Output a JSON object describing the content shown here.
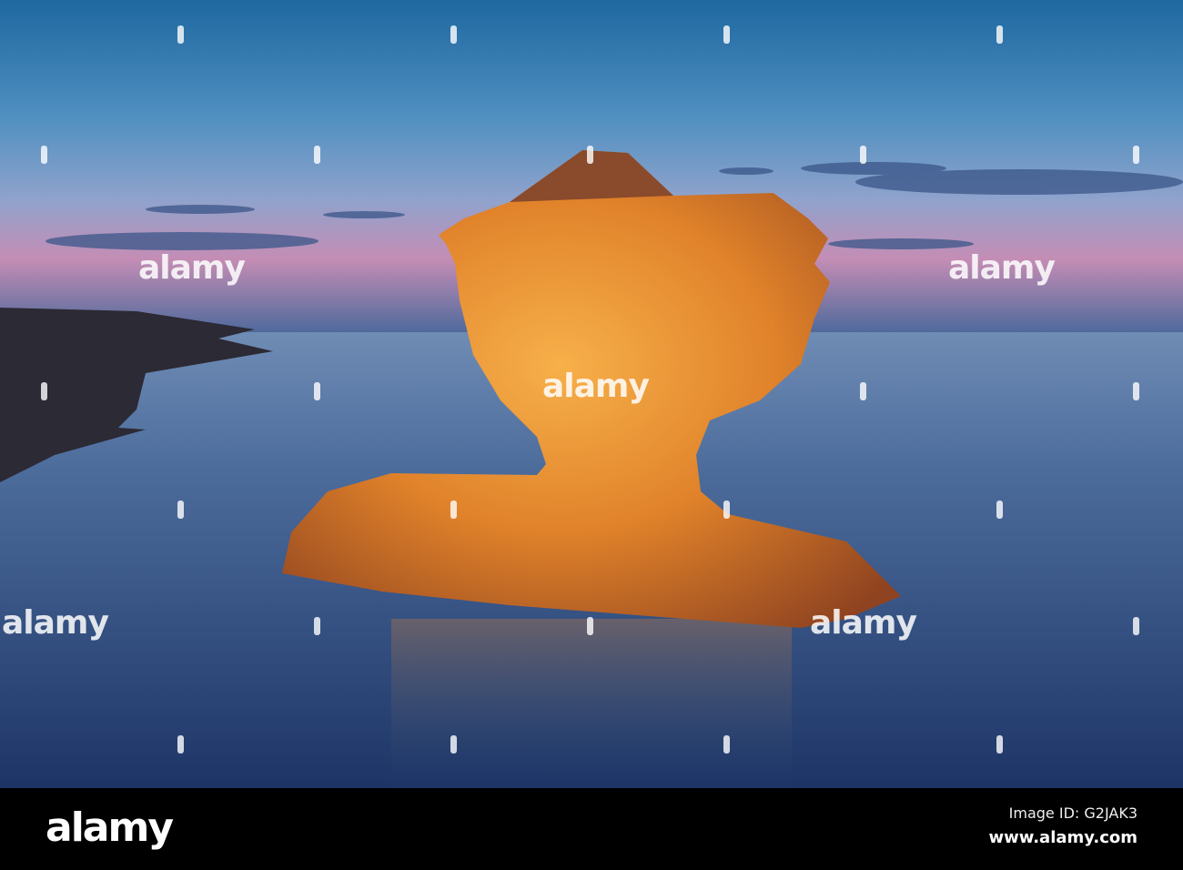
{
  "watermark": "alamy",
  "footer": {
    "logo": "alamy",
    "image_id": "Image ID: G2JAK3",
    "url": "www.alamy.com"
  },
  "colors": {
    "sky_top": "#1f6aa0",
    "sky_horizon": "#c58fb6",
    "water": "#2d4a78",
    "rock": "#e98a2c"
  }
}
